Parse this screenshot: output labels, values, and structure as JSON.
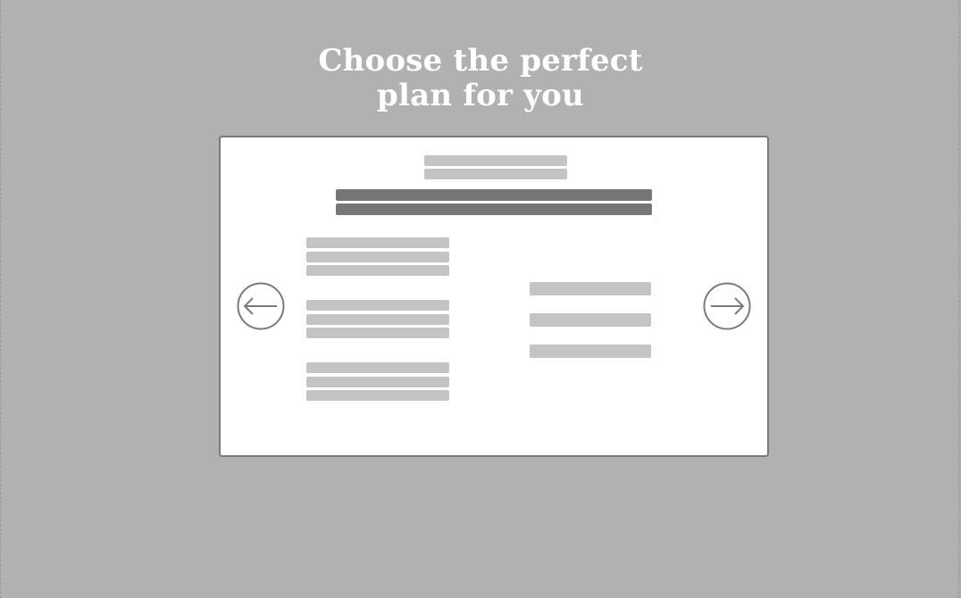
{
  "heading": {
    "line1": "Choose the perfect",
    "line2": "plan for you"
  },
  "carousel": {
    "prev_icon": "arrow-left-circle-icon",
    "next_icon": "arrow-right-circle-icon"
  },
  "colors": {
    "background": "#b1b1b1",
    "card": "#ffffff",
    "placeholder_light": "#c4c4c4",
    "placeholder_dark": "#767676",
    "title": "#ffffff"
  }
}
